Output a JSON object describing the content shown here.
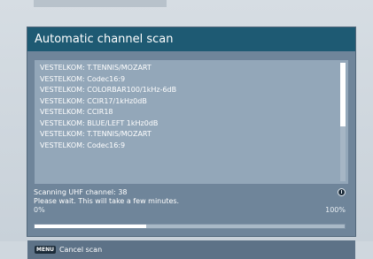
{
  "dialog": {
    "title": "Automatic channel scan"
  },
  "channels": [
    "VESTELKOM: T.TENNIS/MOZART",
    "VESTELKOM: Codec16:9",
    "VESTELKOM: COLORBAR100/1kHz-6dB",
    "VESTELKOM: CCIR17/1kHz0dB",
    "VESTELKOM: CCIR18",
    "VESTELKOM: BLUE/LEFT 1kHz0dB",
    "VESTELKOM: T.TENNIS/MOZART",
    "VESTELKOM: Codec16:9"
  ],
  "status": {
    "scanning_text": "Scanning UHF channel: 38",
    "wait_text": "Please wait. This will take a few minutes.",
    "pct_min": "0%",
    "pct_max": "100%",
    "progress_fraction": 0.36,
    "icon": "clock-icon"
  },
  "footer": {
    "menu_key": "MENU",
    "cancel_text": "Cancel scan"
  },
  "colors": {
    "title_bar": "#1e5a73",
    "panel": "#6f859a",
    "progress_fill": "#ffffff"
  }
}
